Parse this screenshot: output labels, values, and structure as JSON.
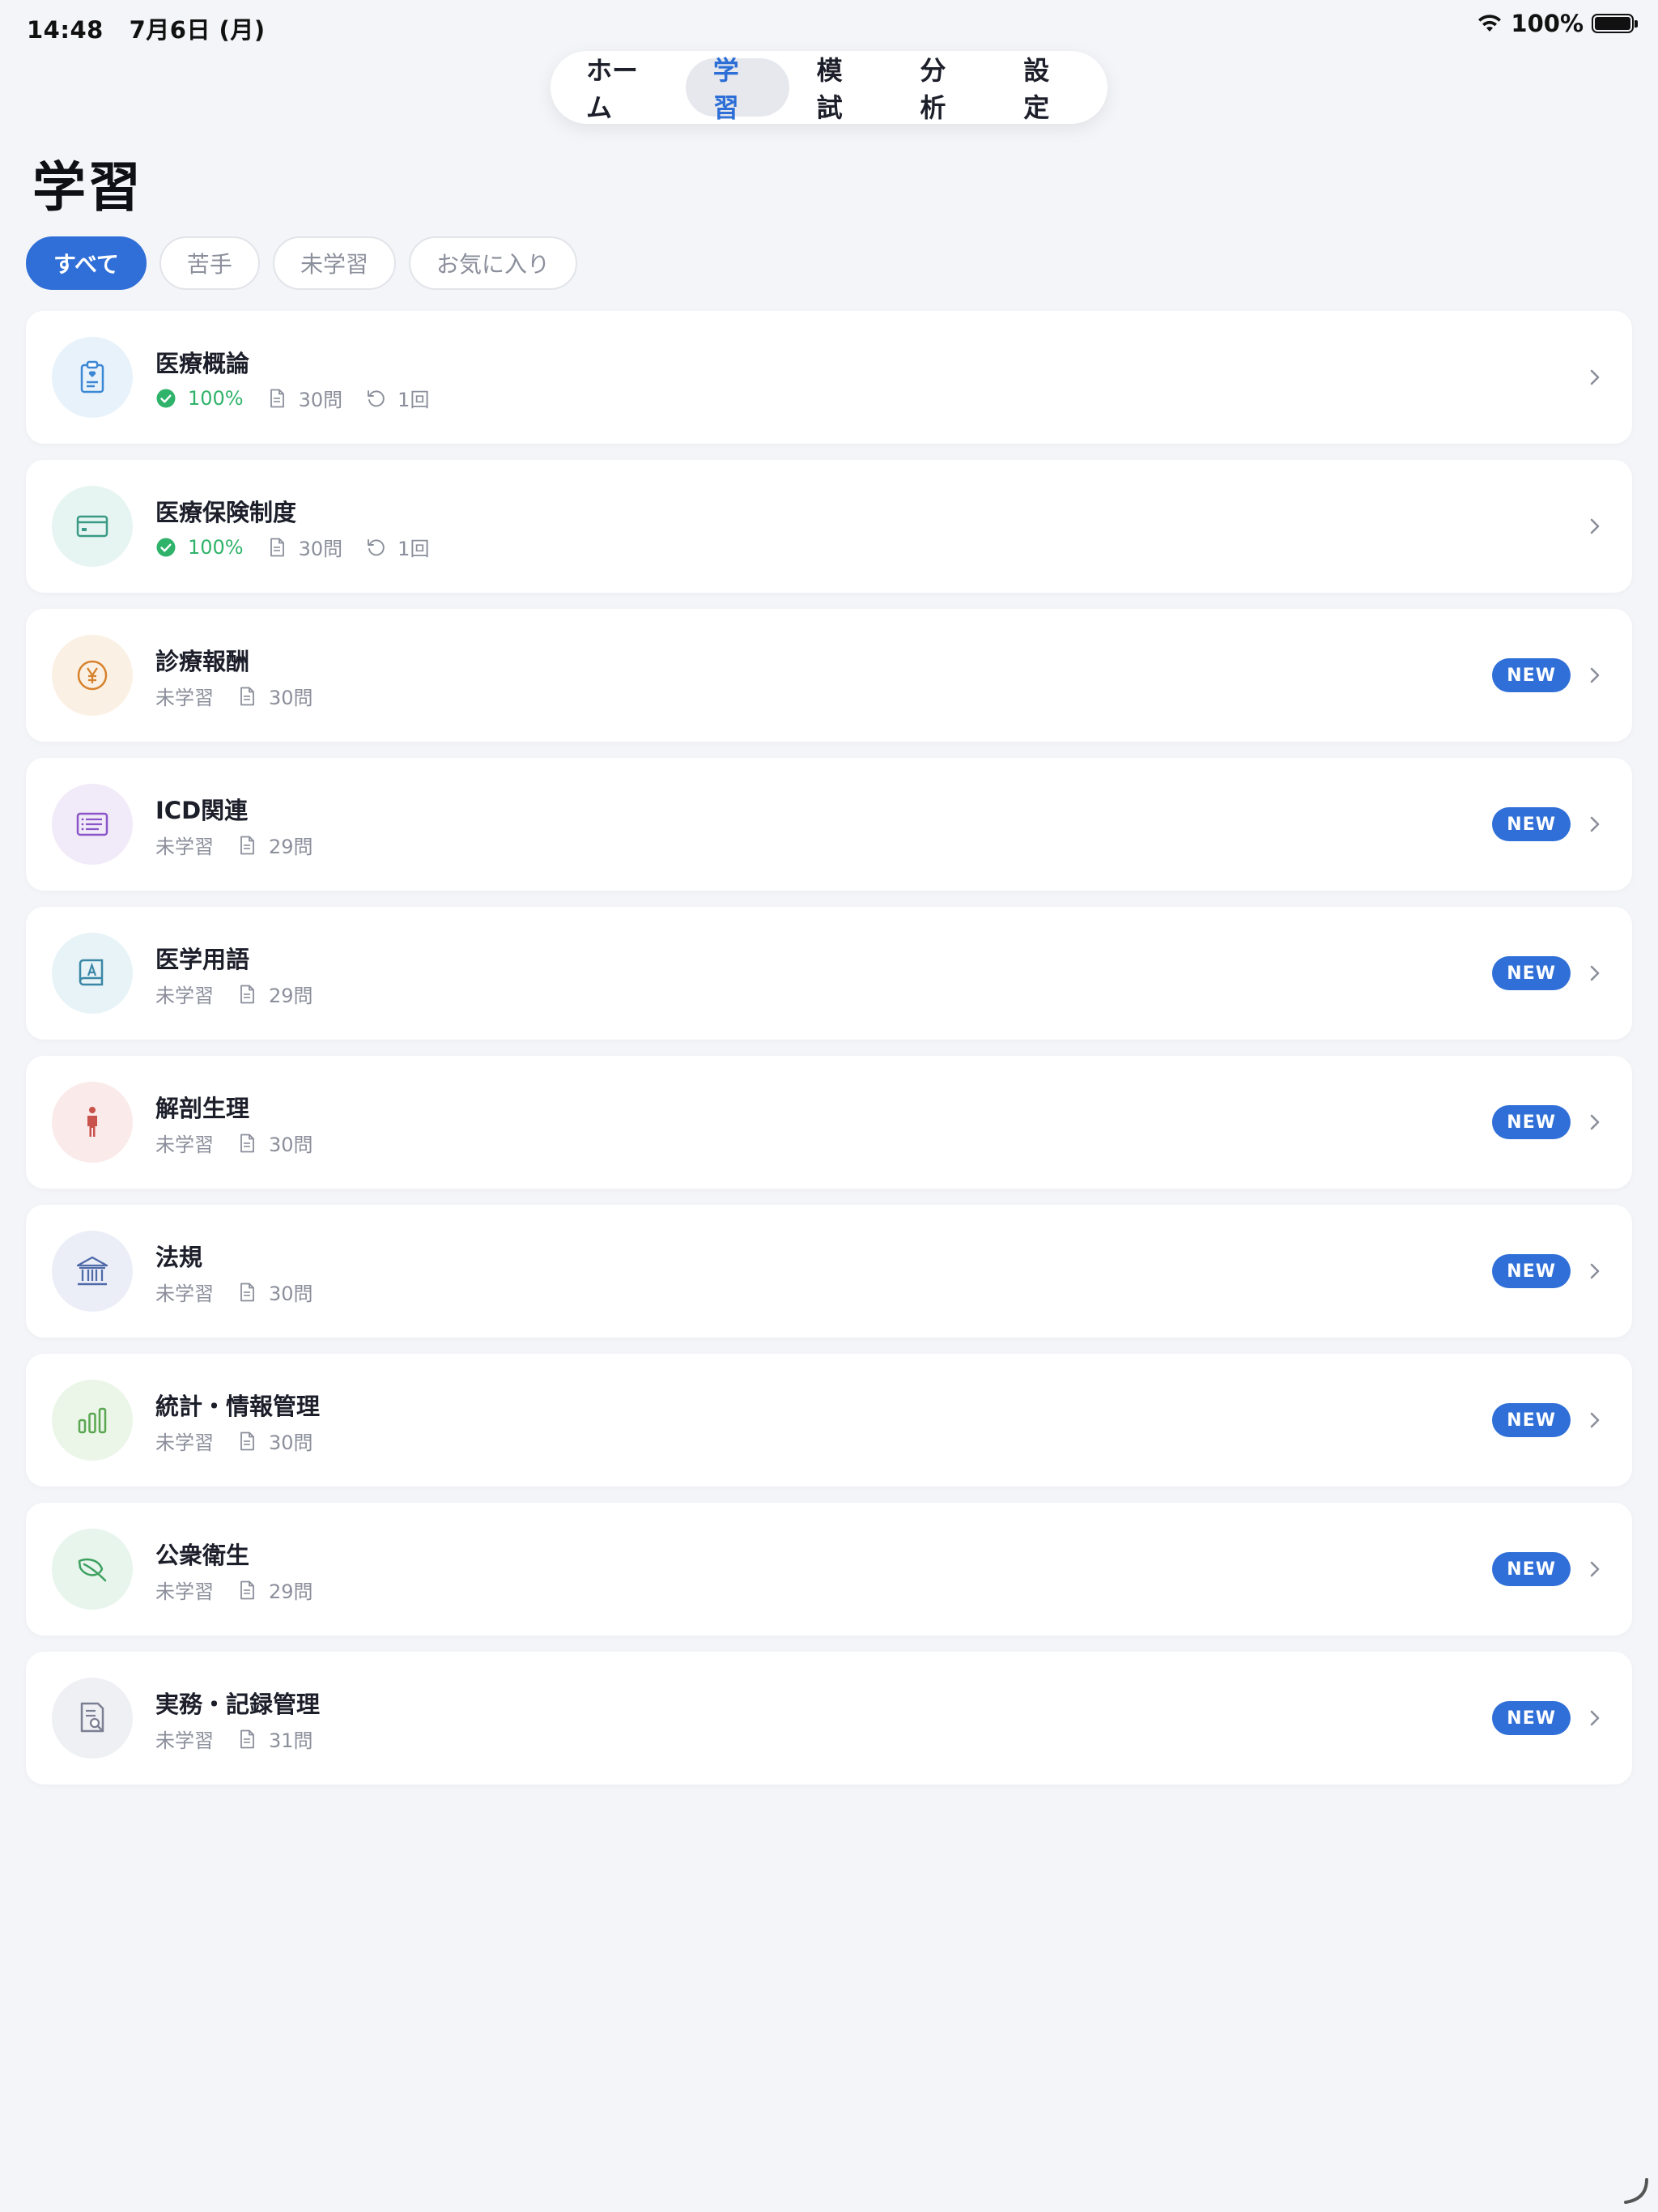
{
  "status": {
    "time": "14:48",
    "date": "7月6日 (月)",
    "battery": "100%"
  },
  "tabs": [
    {
      "label": "ホーム",
      "active": false
    },
    {
      "label": "学習",
      "active": true
    },
    {
      "label": "模試",
      "active": false
    },
    {
      "label": "分析",
      "active": false
    },
    {
      "label": "設定",
      "active": false
    }
  ],
  "page": {
    "title": "学習"
  },
  "filters": [
    {
      "label": "すべて",
      "active": true
    },
    {
      "label": "苦手",
      "active": false
    },
    {
      "label": "未学習",
      "active": false
    },
    {
      "label": "お気に入り",
      "active": false
    }
  ],
  "subjects": [
    {
      "title": "医療概論",
      "status": "100%",
      "completed": true,
      "questions": "30問",
      "reviews": "1回",
      "new": false,
      "icon": "clipboard-heart-icon",
      "color": "#3a87d4",
      "bg": "#e8f2fb"
    },
    {
      "title": "医療保険制度",
      "status": "100%",
      "completed": true,
      "questions": "30問",
      "reviews": "1回",
      "new": false,
      "icon": "credit-card-icon",
      "color": "#3a9a86",
      "bg": "#e6f5f1"
    },
    {
      "title": "診療報酬",
      "status": "未学習",
      "completed": false,
      "questions": "30問",
      "new": true,
      "badge": "NEW",
      "icon": "yen-coin-icon",
      "color": "#d6822c",
      "bg": "#fbf0e4"
    },
    {
      "title": "ICD関連",
      "status": "未学習",
      "completed": false,
      "questions": "29問",
      "new": true,
      "badge": "NEW",
      "icon": "list-card-icon",
      "color": "#8a55c8",
      "bg": "#f1eaf8"
    },
    {
      "title": "医学用語",
      "status": "未学習",
      "completed": false,
      "questions": "29問",
      "new": true,
      "badge": "NEW",
      "icon": "dictionary-book-icon",
      "color": "#3b87a8",
      "bg": "#e7f3f6"
    },
    {
      "title": "解剖生理",
      "status": "未学習",
      "completed": false,
      "questions": "30問",
      "new": true,
      "badge": "NEW",
      "icon": "human-figure-icon",
      "color": "#c9524d",
      "bg": "#fbeaea"
    },
    {
      "title": "法規",
      "status": "未学習",
      "completed": false,
      "questions": "30問",
      "new": true,
      "badge": "NEW",
      "icon": "building-columns-icon",
      "color": "#4f6aa8",
      "bg": "#ebeef7"
    },
    {
      "title": "統計・情報管理",
      "status": "未学習",
      "completed": false,
      "questions": "30問",
      "new": true,
      "badge": "NEW",
      "icon": "bar-chart-icon",
      "color": "#5aa651",
      "bg": "#ebf6e9"
    },
    {
      "title": "公衆衛生",
      "status": "未学習",
      "completed": false,
      "questions": "29問",
      "new": true,
      "badge": "NEW",
      "icon": "leaf-icon",
      "color": "#3ea05f",
      "bg": "#e7f5ec"
    },
    {
      "title": "実務・記録管理",
      "status": "未学習",
      "completed": false,
      "questions": "31問",
      "new": true,
      "badge": "NEW",
      "icon": "document-search-icon",
      "color": "#7b7f92",
      "bg": "#eff0f4"
    }
  ]
}
